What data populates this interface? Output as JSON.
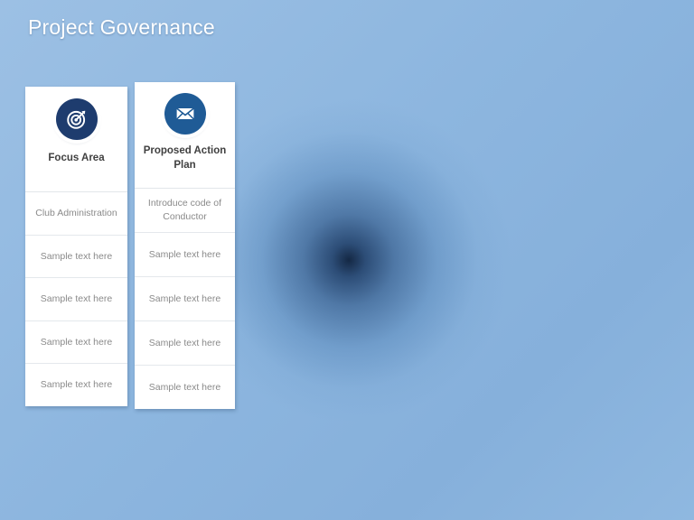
{
  "slide": {
    "title": "Project Governance",
    "background": {
      "base_color": "#8db6df",
      "vignette_color": "#0a1c37"
    }
  },
  "columns": [
    {
      "icon": "target-icon",
      "icon_color": "#1e3c6e",
      "title": "Focus Area",
      "cells": [
        "Club Administration",
        "Sample text here",
        "Sample text here",
        "Sample text here",
        "Sample text here"
      ]
    },
    {
      "icon": "envelope-icon",
      "icon_color": "#1f5b96",
      "title": "Proposed Action Plan",
      "cells": [
        "Introduce code of Conductor",
        "Sample text here",
        "Sample text here",
        "Sample text here",
        "Sample text here"
      ]
    }
  ]
}
